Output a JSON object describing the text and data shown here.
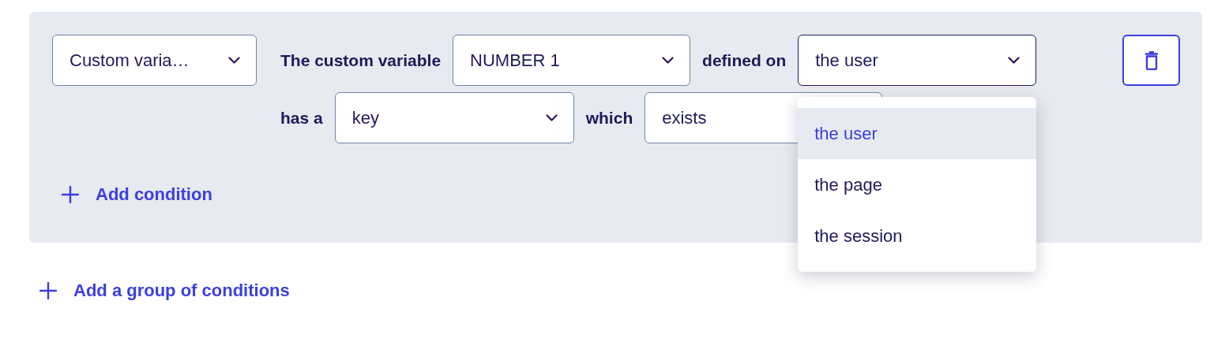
{
  "condition_group": {
    "attribute_select": {
      "value": "Custom varia…"
    },
    "rows": [
      {
        "items": [
          {
            "kind": "label",
            "text": "The custom variable"
          },
          {
            "kind": "select",
            "value": "NUMBER 1",
            "open": false
          },
          {
            "kind": "label",
            "text": "defined on"
          },
          {
            "kind": "select",
            "value": "the user",
            "open": true,
            "menu": [
              {
                "label": "the user",
                "selected": true
              },
              {
                "label": "the page",
                "selected": false
              },
              {
                "label": "the session",
                "selected": false
              }
            ]
          }
        ]
      },
      {
        "items": [
          {
            "kind": "label",
            "text": "has a"
          },
          {
            "kind": "select",
            "value": "key",
            "open": false
          },
          {
            "kind": "label",
            "text": "which"
          },
          {
            "kind": "field",
            "value": "exists"
          }
        ]
      }
    ],
    "add_condition": {
      "label": "Add condition"
    }
  },
  "add_group": {
    "label": "Add a group of conditions"
  }
}
